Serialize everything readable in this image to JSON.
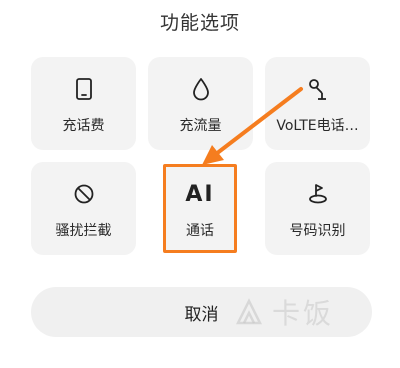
{
  "sheet": {
    "title": "功能选项"
  },
  "options": [
    {
      "icon": "phone-icon",
      "label": "充话费"
    },
    {
      "icon": "water-drop-icon",
      "label": "充流量"
    },
    {
      "icon": "volte-antenna-icon",
      "label": "VoLTE电话…"
    },
    {
      "icon": "block-icon",
      "label": "骚扰拦截"
    },
    {
      "icon": "ai-text-icon",
      "icon_text": "AI",
      "label": "通话"
    },
    {
      "icon": "location-pin-icon",
      "label": "号码识别"
    }
  ],
  "cancel": {
    "label": "取消"
  },
  "watermark": {
    "text": "卡饭"
  },
  "colors": {
    "highlight": "#f57d1f",
    "tile_bg": "#f3f3f3"
  }
}
